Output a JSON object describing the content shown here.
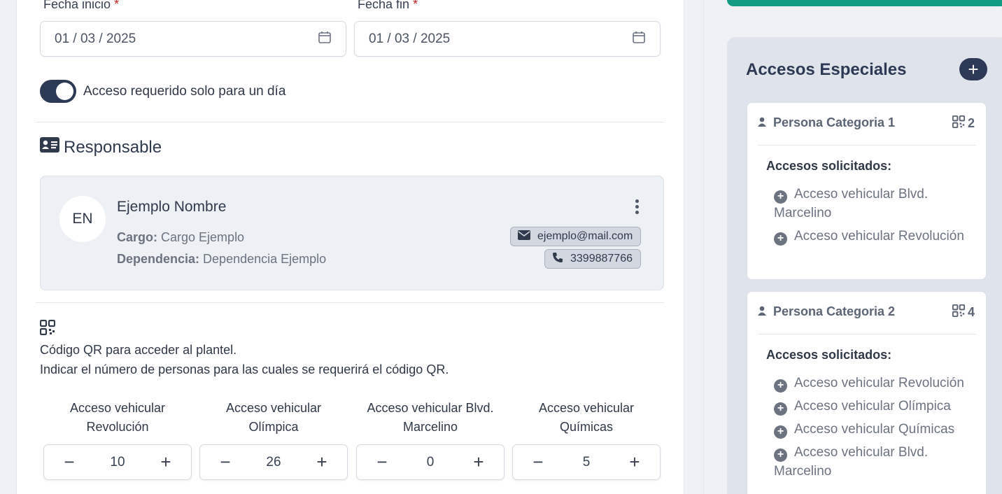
{
  "dates": {
    "start_label": "Fecha inicio",
    "start_required": "*",
    "start_value": "01 / 03 / 2025",
    "end_label": "Fecha fin",
    "end_required": "*",
    "end_value": "01 / 03 / 2025"
  },
  "toggle": {
    "label": "Acceso requerido solo para un día",
    "on": true
  },
  "responsable": {
    "title": "Responsable",
    "initials": "EN",
    "name": "Ejemplo Nombre",
    "cargo_label": "Cargo:",
    "cargo": "Cargo Ejemplo",
    "dependencia_label": "Dependencia:",
    "dependencia": "Dependencia Ejemplo",
    "email": "ejemplo@mail.com",
    "phone": "3399887766"
  },
  "qr": {
    "line1": "Código QR para acceder al plantel.",
    "line2": "Indicar el número de personas para las cuales se requerirá el código QR.",
    "counters": [
      {
        "label": "Acceso vehicular Revolución",
        "value": "10"
      },
      {
        "label": "Acceso vehicular Olímpica",
        "value": "26"
      },
      {
        "label": "Acceso vehicular Blvd. Marcelino",
        "value": "0"
      },
      {
        "label": "Acceso vehicular Químicas",
        "value": "5"
      }
    ],
    "minus": "−",
    "plus": "+"
  },
  "side": {
    "title": "Accesos Especiales",
    "add": "+",
    "categories": [
      {
        "name": "Persona Categoria 1",
        "count": "2",
        "sub": "Accesos solicitados:",
        "items": [
          "Acceso vehicular Blvd. Marcelino",
          "Acceso vehicular Revolución"
        ]
      },
      {
        "name": "Persona Categoria 2",
        "count": "4",
        "sub": "Accesos solicitados:",
        "items": [
          "Acceso vehicular Revolución",
          "Acceso vehicular Olímpica",
          "Acceso vehicular Químicas",
          "Acceso vehicular Blvd. Marcelino"
        ]
      }
    ]
  },
  "colors": {
    "accent": "#2d3a55",
    "teal": "#139a83",
    "required": "#c02020"
  }
}
